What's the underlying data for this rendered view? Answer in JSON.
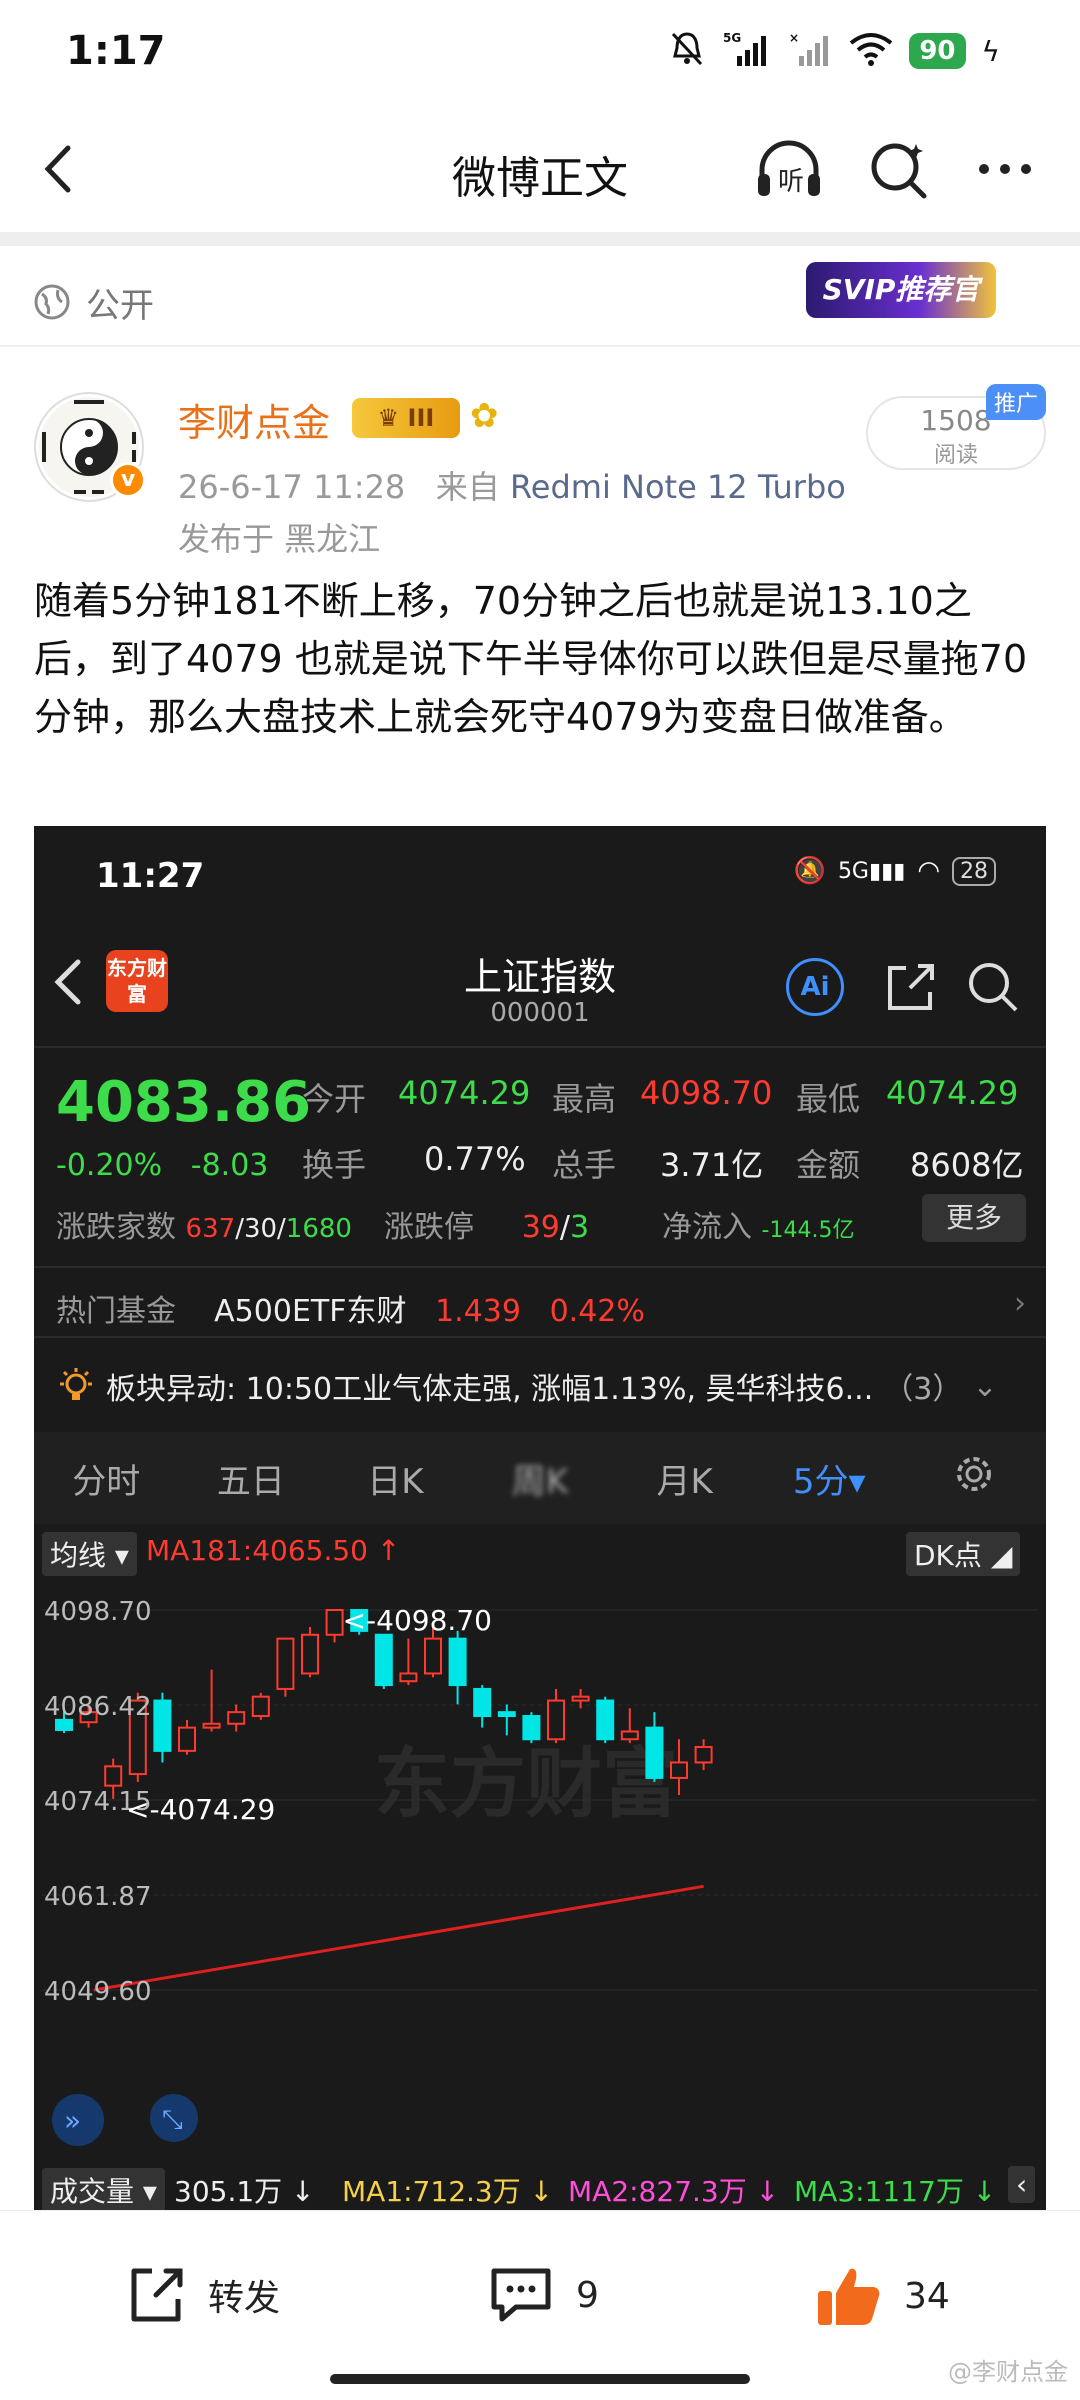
{
  "status": {
    "time": "1:17",
    "signal": "5G",
    "battery": "90"
  },
  "nav": {
    "title": "微博正文",
    "listen_label": "听"
  },
  "visibility": {
    "label": "公开",
    "svip_badge": "SVIP推荐官"
  },
  "post": {
    "author": "李财点金",
    "level_badge": "III",
    "date": "26-6-17 11:28",
    "source_prefix": "来自",
    "device": "Redmi Note 12 Turbo",
    "location": "发布于 黑龙江",
    "reads_count": "1508",
    "reads_label": "阅读",
    "promo_tag": "推广",
    "text": "随着5分钟181不断上移，70分钟之后也就是说13.10之后，到了4079 也就是说下午半导体你可以跌但是尽量拖70分钟，那么大盘技术上就会死守4079为变盘日做准备。"
  },
  "screenshot": {
    "time": "11:27",
    "battery": "28",
    "logo_text": "东方财富",
    "index_name": "上证指数",
    "index_code": "000001",
    "ai_label": "Ai",
    "price": "4083.86",
    "change_pct": "-0.20%",
    "change_abs": "-8.03",
    "open_label": "今开",
    "open": "4074.29",
    "high_label": "最高",
    "high": "4098.70",
    "low_label": "最低",
    "low": "4074.29",
    "turnover_label": "换手",
    "turnover": "0.77%",
    "volume_label": "总手",
    "volume": "3.71亿",
    "amount_label": "金额",
    "amount": "8608亿",
    "breadth_label": "涨跌家数",
    "breadth_up": "637",
    "breadth_flat": "/30/",
    "breadth_down": "1680",
    "limit_label": "涨跌停",
    "limit_up": "39",
    "limit_sep": "/",
    "limit_down": "3",
    "netflow_label": "净流入",
    "netflow": "-144.5亿",
    "more_label": "更多",
    "fund_label": "热门基金",
    "fund_name": "A500ETF东财",
    "fund_price": "1.439",
    "fund_pct": "0.42%",
    "alert_text": "板块异动: 10:50工业气体走强, 涨幅1.13%, 昊华科技6...",
    "alert_count": "（3）",
    "tabs": [
      "分时",
      "五日",
      "日K",
      "周K",
      "月K",
      "5分▾"
    ],
    "avg_label": "均线",
    "ma181_label": "MA181:4065.50 ↑",
    "dk_label": "DK点",
    "watermark": "东方财富",
    "vol_label": "成交量",
    "vol_value": "305.1万 ↓",
    "ma1": "MA1:712.3万 ↓",
    "ma2": "MA2:827.3万 ↓",
    "ma3": "MA3:1117万 ↓"
  },
  "chart_data": {
    "type": "candlestick",
    "title": "上证指数 5分",
    "y_ticks": [
      "4098.70",
      "4086.42",
      "4074.15",
      "4061.87",
      "4049.60"
    ],
    "ylim": [
      4049.6,
      4098.7
    ],
    "annotations": [
      "<-4098.70",
      "<-4074.29"
    ],
    "candles": [
      {
        "o": 4084.5,
        "h": 4086.0,
        "l": 4082.8,
        "c": 4083.2
      },
      {
        "o": 4084.2,
        "h": 4086.5,
        "l": 4083.5,
        "c": 4085.5
      },
      {
        "o": 4076.0,
        "h": 4079.5,
        "l": 4074.3,
        "c": 4078.5
      },
      {
        "o": 4077.5,
        "h": 4088.0,
        "l": 4076.5,
        "c": 4087.0
      },
      {
        "o": 4087.0,
        "h": 4088.0,
        "l": 4079.0,
        "c": 4080.5
      },
      {
        "o": 4080.5,
        "h": 4084.5,
        "l": 4080.0,
        "c": 4083.5
      },
      {
        "o": 4083.5,
        "h": 4091.0,
        "l": 4083.0,
        "c": 4084.0
      },
      {
        "o": 4084.0,
        "h": 4086.5,
        "l": 4083.0,
        "c": 4085.5
      },
      {
        "o": 4085.0,
        "h": 4088.0,
        "l": 4084.5,
        "c": 4087.5
      },
      {
        "o": 4088.5,
        "h": 4093.0,
        "l": 4087.5,
        "c": 4095.0
      },
      {
        "o": 4090.5,
        "h": 4096.5,
        "l": 4090.0,
        "c": 4095.5
      },
      {
        "o": 4095.5,
        "h": 4098.7,
        "l": 4094.5,
        "c": 4098.7
      },
      {
        "o": 4098.7,
        "h": 4098.7,
        "l": 4095.5,
        "c": 4096.0
      },
      {
        "o": 4095.5,
        "h": 4095.5,
        "l": 4088.5,
        "c": 4089.0
      },
      {
        "o": 4089.5,
        "h": 4095.0,
        "l": 4089.0,
        "c": 4090.5
      },
      {
        "o": 4090.5,
        "h": 4096.5,
        "l": 4090.0,
        "c": 4095.0
      },
      {
        "o": 4095.0,
        "h": 4096.0,
        "l": 4086.5,
        "c": 4089.0
      },
      {
        "o": 4088.5,
        "h": 4089.0,
        "l": 4083.5,
        "c": 4085.0
      },
      {
        "o": 4085.5,
        "h": 4086.5,
        "l": 4082.5,
        "c": 4085.0
      },
      {
        "o": 4085.0,
        "h": 4085.5,
        "l": 4081.5,
        "c": 4082.0
      },
      {
        "o": 4082.0,
        "h": 4088.5,
        "l": 4081.5,
        "c": 4087.0
      },
      {
        "o": 4087.0,
        "h": 4088.5,
        "l": 4086.0,
        "c": 4087.5
      },
      {
        "o": 4087.0,
        "h": 4087.5,
        "l": 4081.5,
        "c": 4082.0
      },
      {
        "o": 4082.0,
        "h": 4086.0,
        "l": 4081.5,
        "c": 4083.0
      },
      {
        "o": 4083.5,
        "h": 4085.5,
        "l": 4076.5,
        "c": 4077.0
      },
      {
        "o": 4077.0,
        "h": 4082.0,
        "l": 4074.8,
        "c": 4079.0
      },
      {
        "o": 4079.0,
        "h": 4082.0,
        "l": 4078.0,
        "c": 4081.0
      }
    ],
    "ma181": {
      "start": 4049.6,
      "end": 4063.0,
      "latest": "4065.50"
    }
  },
  "footer": {
    "repost_label": "转发",
    "comments": "9",
    "likes": "34"
  },
  "watermark_text": "@李财点金",
  "colors": {
    "up": "#ff3b30",
    "down": "#00e5e5",
    "author": "#e8711a",
    "accent": "#3f8fff"
  }
}
